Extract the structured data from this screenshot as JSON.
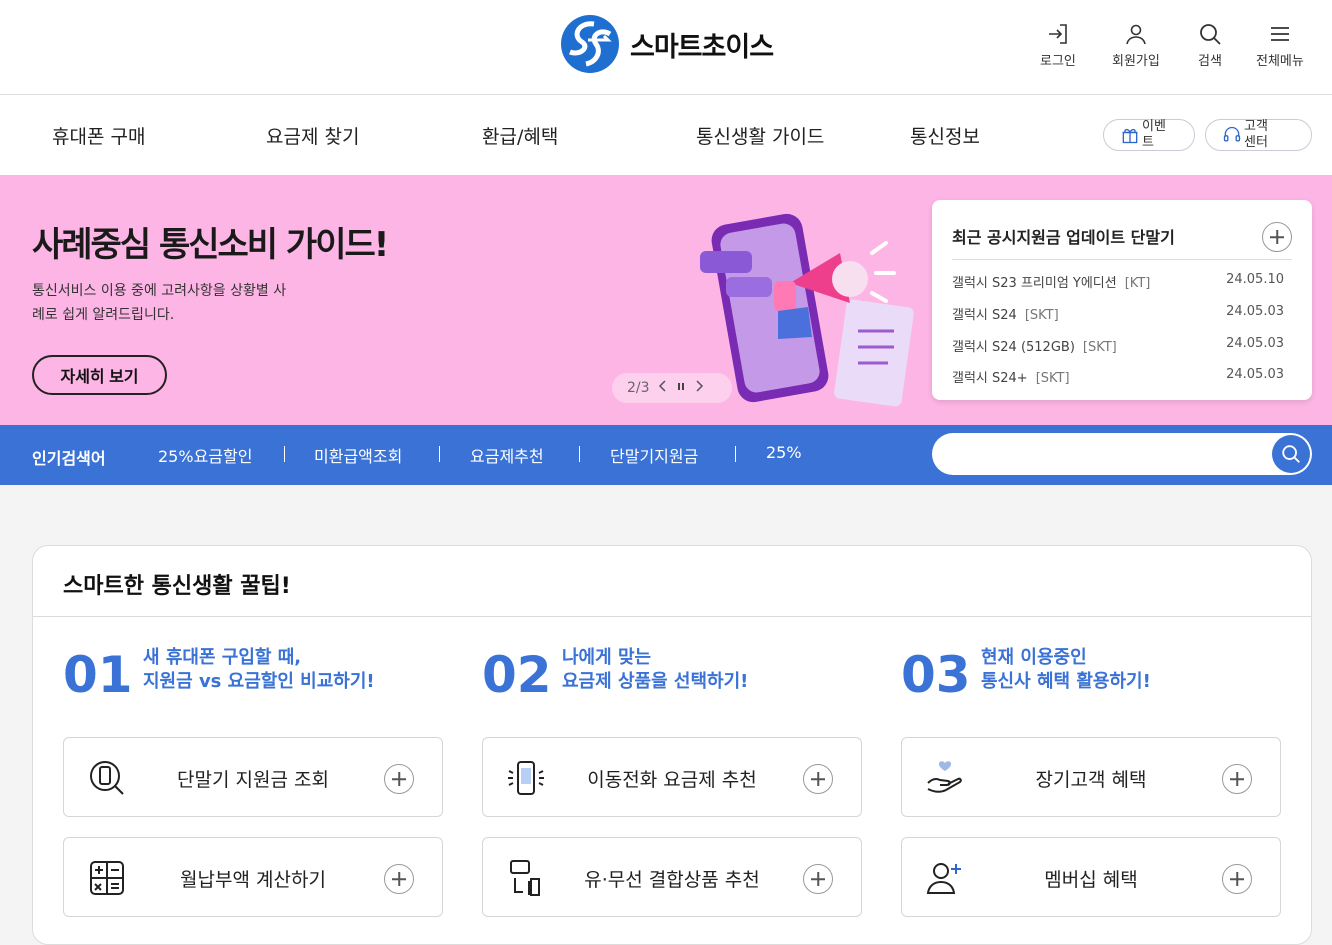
{
  "brand": {
    "name": "스마트초이스"
  },
  "utility": [
    {
      "label": "로그인",
      "icon": "login-icon"
    },
    {
      "label": "회원가입",
      "icon": "user-icon"
    },
    {
      "label": "검색",
      "icon": "search-icon"
    },
    {
      "label": "전체메뉴",
      "icon": "menu-icon"
    }
  ],
  "gnb": [
    "휴대폰 구매",
    "요금제 찾기",
    "환급/혜택",
    "통신생활 가이드",
    "통신정보"
  ],
  "quick": [
    {
      "label": "이벤트",
      "icon": "gift-icon"
    },
    {
      "label": "고객센터",
      "icon": "headset-icon"
    }
  ],
  "hero": {
    "title": "사례중심 통신소비 가이드!",
    "desc": "통신서비스 이용 중에 고려사항을 상황별 사례로 쉽게 알려드립니다.",
    "button": "자세히 보기",
    "page": "2/3"
  },
  "notice": {
    "title": "최근 공시지원금 업데이트 단말기",
    "items": [
      {
        "name": "갤럭시 S23 프리미엄 Y에디션",
        "carrier": "[KT]",
        "date": "24.05.10"
      },
      {
        "name": "갤럭시 S24",
        "carrier": "[SKT]",
        "date": "24.05.03"
      },
      {
        "name": "갤럭시 S24 (512GB)",
        "carrier": "[SKT]",
        "date": "24.05.03"
      },
      {
        "name": "갤럭시 S24+",
        "carrier": "[SKT]",
        "date": "24.05.03"
      }
    ]
  },
  "keywords": {
    "title": "인기검색어",
    "items": [
      "25%요금할인",
      "미환급액조회",
      "요금제추천",
      "단말기지원금",
      "25%"
    ]
  },
  "search": {
    "placeholder": ""
  },
  "tips": {
    "title": "스마트한 통신생활 꿀팁!",
    "columns": [
      {
        "num": "01",
        "line1": "새 휴대폰 구입할 때,",
        "line2": "지원금 vs 요금할인 비교하기!",
        "boxes": [
          {
            "label": "단말기 지원금 조회",
            "icon": "phone-search-icon"
          },
          {
            "label": "월납부액 계산하기",
            "icon": "calculator-icon"
          }
        ]
      },
      {
        "num": "02",
        "line1": "나에게 맞는",
        "line2": "요금제 상품을 선택하기!",
        "boxes": [
          {
            "label": "이동전화 요금제 추천",
            "icon": "phone-signal-icon"
          },
          {
            "label": "유·무선 결합상품 추천",
            "icon": "devices-icon"
          }
        ]
      },
      {
        "num": "03",
        "line1": "현재 이용중인",
        "line2": "통신사 혜택 활용하기!",
        "boxes": [
          {
            "label": "장기고객 혜택",
            "icon": "heart-hand-icon"
          },
          {
            "label": "멤버십 혜택",
            "icon": "user-add-icon"
          }
        ]
      }
    ]
  }
}
